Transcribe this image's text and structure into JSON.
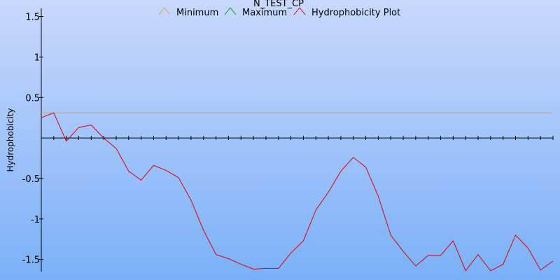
{
  "colors": {
    "background_top": "#c8d8fc",
    "background_bottom": "#7ab0f8",
    "minimum": "#e8a040",
    "maximum": "#109010",
    "hydrophobicity": "#e00000",
    "axis": "#000000"
  },
  "chart_data": {
    "type": "line",
    "title": "N_TEST_CP",
    "xlabel": "",
    "ylabel": "Hydrophobicity",
    "ylim": [
      -1.65,
      1.6
    ],
    "xlim": [
      1,
      42
    ],
    "grid": false,
    "legend_position": "top-center",
    "y_ticks": [
      {
        "value": 1.5,
        "label": "1.5"
      },
      {
        "value": 1,
        "label": "1"
      },
      {
        "value": 0.5,
        "label": "0.5"
      },
      {
        "value": -0.5,
        "label": "-0.5"
      },
      {
        "value": -1,
        "label": "-1"
      },
      {
        "value": -1.5,
        "label": "-1.5"
      }
    ],
    "x_ticks": [
      1,
      2,
      3,
      4,
      5,
      6,
      7,
      8,
      9,
      10,
      11,
      12,
      13,
      14,
      15,
      16,
      17,
      18,
      19,
      20,
      21,
      22,
      23,
      24,
      25,
      26,
      27,
      28,
      29,
      30,
      31,
      32,
      33,
      34,
      35,
      36,
      37,
      38,
      39,
      40,
      41,
      42
    ],
    "series": [
      {
        "name": "Minimum",
        "color": "#e8a040",
        "x": [
          1,
          42
        ],
        "y": [
          0.31,
          0.31
        ]
      },
      {
        "name": "Maximum",
        "color": "#109010",
        "x": [],
        "y": []
      },
      {
        "name": "Hydrophobicity Plot",
        "color": "#e00000",
        "x": [
          1,
          2,
          3,
          4,
          5,
          6,
          7,
          8,
          9,
          10,
          11,
          12,
          13,
          14,
          15,
          16,
          17,
          18,
          19,
          20,
          21,
          22,
          23,
          24,
          25,
          26,
          27,
          28,
          29,
          30,
          31,
          32,
          33,
          34,
          35,
          36,
          37,
          38,
          39,
          40,
          41,
          42
        ],
        "y": [
          0.25,
          0.31,
          -0.04,
          0.13,
          0.16,
          0.0,
          -0.13,
          -0.41,
          -0.52,
          -0.34,
          -0.4,
          -0.49,
          -0.77,
          -1.14,
          -1.44,
          -1.49,
          -1.56,
          -1.62,
          -1.61,
          -1.61,
          -1.42,
          -1.27,
          -0.89,
          -0.67,
          -0.41,
          -0.24,
          -0.36,
          -0.72,
          -1.2,
          -1.4,
          -1.58,
          -1.45,
          -1.45,
          -1.27,
          -1.64,
          -1.44,
          -1.64,
          -1.56,
          -1.2,
          -1.36,
          -1.63,
          -1.52
        ]
      }
    ]
  }
}
